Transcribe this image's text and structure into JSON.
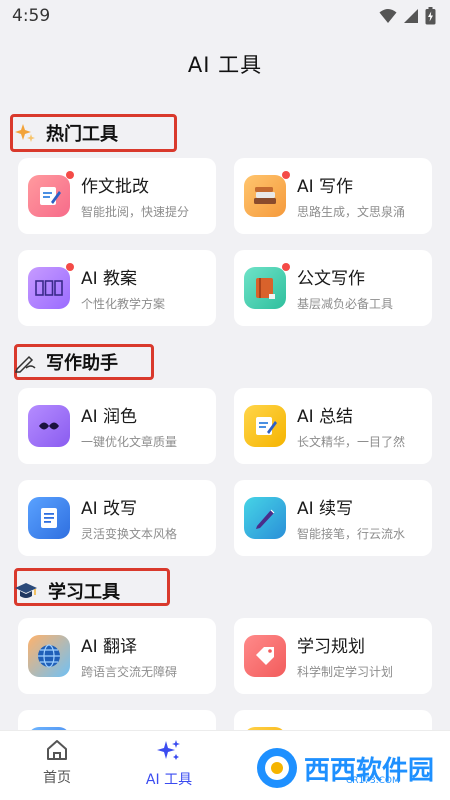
{
  "status": {
    "time": "4:59"
  },
  "header": {
    "title": "AI 工具"
  },
  "sections": [
    {
      "title": "热门工具",
      "cards": [
        {
          "title": "作文批改",
          "subtitle": "智能批阅，快速提分"
        },
        {
          "title": "AI 写作",
          "subtitle": "思路生成，文思泉涌"
        },
        {
          "title": "AI 教案",
          "subtitle": "个性化教学方案"
        },
        {
          "title": "公文写作",
          "subtitle": "基层减负必备工具"
        }
      ]
    },
    {
      "title": "写作助手",
      "cards": [
        {
          "title": "AI 润色",
          "subtitle": "一键优化文章质量"
        },
        {
          "title": "AI 总结",
          "subtitle": "长文精华，一目了然"
        },
        {
          "title": "AI 改写",
          "subtitle": "灵活变换文本风格"
        },
        {
          "title": "AI 续写",
          "subtitle": "智能接笔，行云流水"
        }
      ]
    },
    {
      "title": "学习工具",
      "cards": [
        {
          "title": "AI 翻译",
          "subtitle": "跨语言交流无障碍"
        },
        {
          "title": "学习规划",
          "subtitle": "科学制定学习计划"
        }
      ]
    }
  ],
  "bottom_nav": {
    "home": "首页",
    "ai_tools": "AI 工具"
  },
  "watermark": {
    "text": "西西软件园",
    "site": "CR173.COM"
  },
  "colors": {
    "accent": "#3b4cf0",
    "highlight_box": "#d9392c",
    "badge": "#f44b47"
  }
}
